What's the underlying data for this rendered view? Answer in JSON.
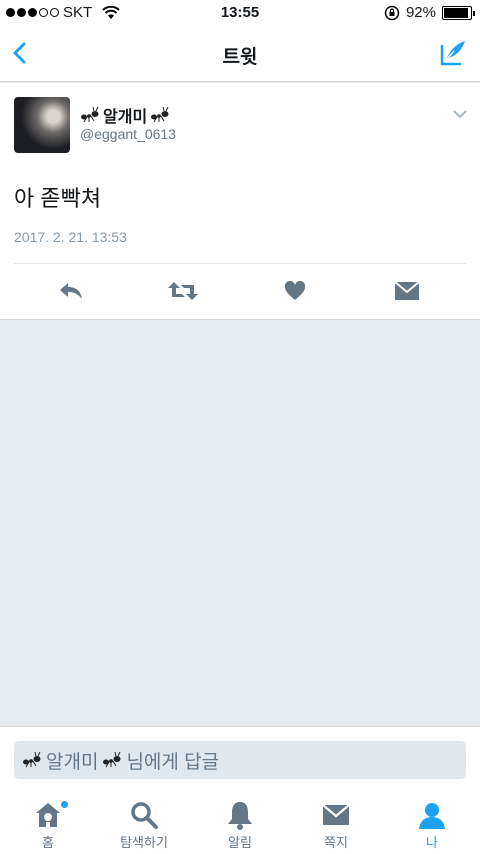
{
  "status_bar": {
    "carrier": "SKT",
    "time": "13:55",
    "battery": "92%",
    "battery_level": 0.92,
    "signal_filled": 3,
    "signal_total": 5
  },
  "nav": {
    "title": "트윗",
    "accent_color": "#1da1f2"
  },
  "tweet": {
    "display_name": "알개미",
    "handle": "@eggant_0613",
    "text": "아 졷빡쳐",
    "timestamp": "2017. 2. 21. 13:53"
  },
  "actions": [
    "reply-icon",
    "retweet-icon",
    "like-icon",
    "direct-message-icon"
  ],
  "reply_bar": {
    "name": "알개미",
    "suffix": "님에게 답글"
  },
  "tabs": [
    {
      "label": "홈",
      "icon": "home-icon"
    },
    {
      "label": "탐색하기",
      "icon": "search-icon"
    },
    {
      "label": "알림",
      "icon": "bell-icon"
    },
    {
      "label": "쪽지",
      "icon": "envelope-icon"
    },
    {
      "label": "나",
      "icon": "profile-icon"
    }
  ]
}
